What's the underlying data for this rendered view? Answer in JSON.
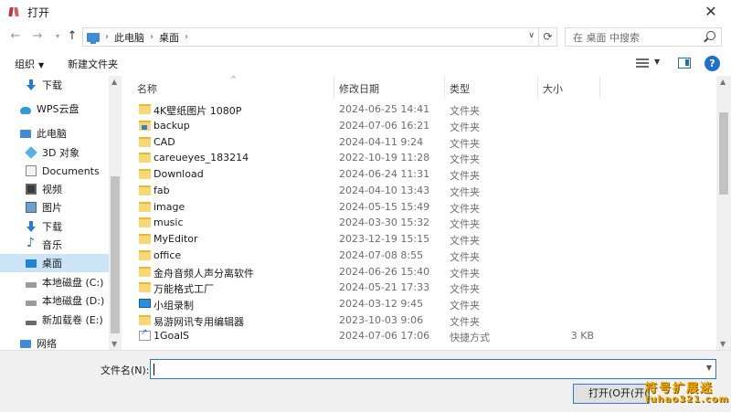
{
  "window": {
    "title": "打开"
  },
  "address": {
    "crumbs": [
      "此电脑",
      "桌面"
    ]
  },
  "search": {
    "placeholder": "在 桌面 中搜索"
  },
  "toolbar": {
    "organize": "组织",
    "new_folder": "新建文件夹"
  },
  "nav": [
    {
      "label": "下载",
      "icon": "download-icon"
    },
    {
      "label": "WPS云盘",
      "icon": "cloud-icon"
    },
    {
      "label": "此电脑",
      "icon": "pc-icon"
    },
    {
      "label": "3D 对象",
      "icon": "3d-objects-icon"
    },
    {
      "label": "Documents",
      "icon": "documents-icon"
    },
    {
      "label": "视频",
      "icon": "video-icon"
    },
    {
      "label": "图片",
      "icon": "pictures-icon"
    },
    {
      "label": "下载",
      "icon": "download-icon"
    },
    {
      "label": "音乐",
      "icon": "music-icon"
    },
    {
      "label": "桌面",
      "icon": "desktop-icon",
      "selected": true
    },
    {
      "label": "本地磁盘 (C:)",
      "icon": "drive-icon"
    },
    {
      "label": "本地磁盘 (D:)",
      "icon": "drive-icon"
    },
    {
      "label": "新加载卷 (E:)",
      "icon": "drive-icon"
    },
    {
      "label": "网络",
      "icon": "network-icon"
    }
  ],
  "columns": {
    "name": "名称",
    "date": "修改日期",
    "type": "类型",
    "size": "大小"
  },
  "files": [
    {
      "name": "4K壁纸图片 1080P",
      "date": "2024-06-25 14:41",
      "type": "文件夹",
      "size": "",
      "icon": "folder-icon"
    },
    {
      "name": "backup",
      "date": "2024-07-06 16:21",
      "type": "文件夹",
      "size": "",
      "icon": "folder-app-icon"
    },
    {
      "name": "CAD",
      "date": "2024-04-11 9:24",
      "type": "文件夹",
      "size": "",
      "icon": "folder-icon"
    },
    {
      "name": "careueyes_183214",
      "date": "2022-10-19 11:28",
      "type": "文件夹",
      "size": "",
      "icon": "folder-icon"
    },
    {
      "name": "Download",
      "date": "2024-06-24 11:31",
      "type": "文件夹",
      "size": "",
      "icon": "folder-icon"
    },
    {
      "name": "fab",
      "date": "2024-04-10 13:43",
      "type": "文件夹",
      "size": "",
      "icon": "folder-icon"
    },
    {
      "name": "image",
      "date": "2024-05-15 15:49",
      "type": "文件夹",
      "size": "",
      "icon": "folder-icon"
    },
    {
      "name": "music",
      "date": "2024-03-30 15:32",
      "type": "文件夹",
      "size": "",
      "icon": "folder-icon"
    },
    {
      "name": "MyEditor",
      "date": "2023-12-19 15:15",
      "type": "文件夹",
      "size": "",
      "icon": "folder-icon"
    },
    {
      "name": "office",
      "date": "2024-07-08 8:55",
      "type": "文件夹",
      "size": "",
      "icon": "folder-icon"
    },
    {
      "name": "金舟音频人声分离软件",
      "date": "2024-06-26 15:40",
      "type": "文件夹",
      "size": "",
      "icon": "folder-icon"
    },
    {
      "name": "万能格式工厂",
      "date": "2024-05-21 17:33",
      "type": "文件夹",
      "size": "",
      "icon": "folder-icon"
    },
    {
      "name": "小组录制",
      "date": "2024-03-12 9:45",
      "type": "文件夹",
      "size": "",
      "icon": "screen-folder-icon"
    },
    {
      "name": "易游网讯专用编辑器",
      "date": "2023-10-03 9:06",
      "type": "文件夹",
      "size": "",
      "icon": "folder-icon"
    },
    {
      "name": "1GoalS",
      "date": "2024-07-06 17:06",
      "type": "快捷方式",
      "size": "3 KB",
      "icon": "shortcut-icon"
    }
  ],
  "filename": {
    "label": "文件名(N):",
    "value": ""
  },
  "buttons": {
    "open": "打开(O开(开("
  },
  "watermark": {
    "line1": "符号扩展迷",
    "line2": "fuhao321.com"
  },
  "colors": {
    "accent": "#2a7ad6",
    "selection": "#cce4f7",
    "folder": "#f8d775"
  }
}
